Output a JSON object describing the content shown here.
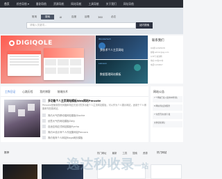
{
  "nav": {
    "items": [
      "首页",
      "综合导航 ▾",
      "番剧导航",
      "资源导航",
      "网站导航",
      "工具导航",
      "关于我们",
      "网址导航"
    ]
  },
  "search": {
    "tabs": [
      "常用",
      "搜索",
      "AI",
      "百度",
      "谷歌",
      "360",
      "必应"
    ],
    "active_tab": 1,
    "placeholder": "请输入关键词...",
    "button_label": "站内搜索"
  },
  "banner": {
    "brand": "DIGIQOLE"
  },
  "tiles": [
    {
      "tag": "Wondertech",
      "text": "多技术个人主页网站"
    },
    {
      "tag": "Lekoson",
      "text": "数据管理网站模板"
    }
  ],
  "sidebar_panel": {
    "title": "联系我们",
    "lines": [
      "QQ群:12345678",
      "邮箱:admin@qq.com",
      "公众号:资源网",
      "地址:XX省XX市",
      "电话:1234567"
    ]
  },
  "content": {
    "tabs": [
      "工作日记",
      "心路历程",
      "我的博客",
      "前端技术"
    ],
    "active_tab": 0,
    "headline": "多功能个人主页网站模板Web网站Pencote",
    "description": "Pencote是使用现代风格和响应式设计的多功能个人主页网站模板，可以作为个人展示网站，适用于个人博客和作品集网站。",
    "list": [
      "简约大气的移动端网站模板Glochie",
      "创意大气的网站模板ZAlly",
      "自适应响应式网站模板Pyrrha",
      "简约UI设计师个人作品集网站Pencora",
      "简约电商个人网站Bloga网页模板"
    ]
  },
  "right_box": {
    "title": "网站公告",
    "rows": [
      "7 个网站已接入使用本地导航",
      "8 网站导航定制服务",
      "7 免费开源主题下载",
      "文章更新通知"
    ]
  },
  "bottom": {
    "left_label": "推荐",
    "tabs": [
      "热门网址",
      "最新",
      "工具",
      "搜索",
      "资源"
    ],
    "right_label": "热门网站"
  },
  "watermark": {
    "text": "逸达秒收录",
    "suffix": "一站"
  },
  "colors": {
    "nav_bg": "#2a2d35",
    "accent": "#2b6cd3",
    "banner_red": "#ff5a4e"
  }
}
